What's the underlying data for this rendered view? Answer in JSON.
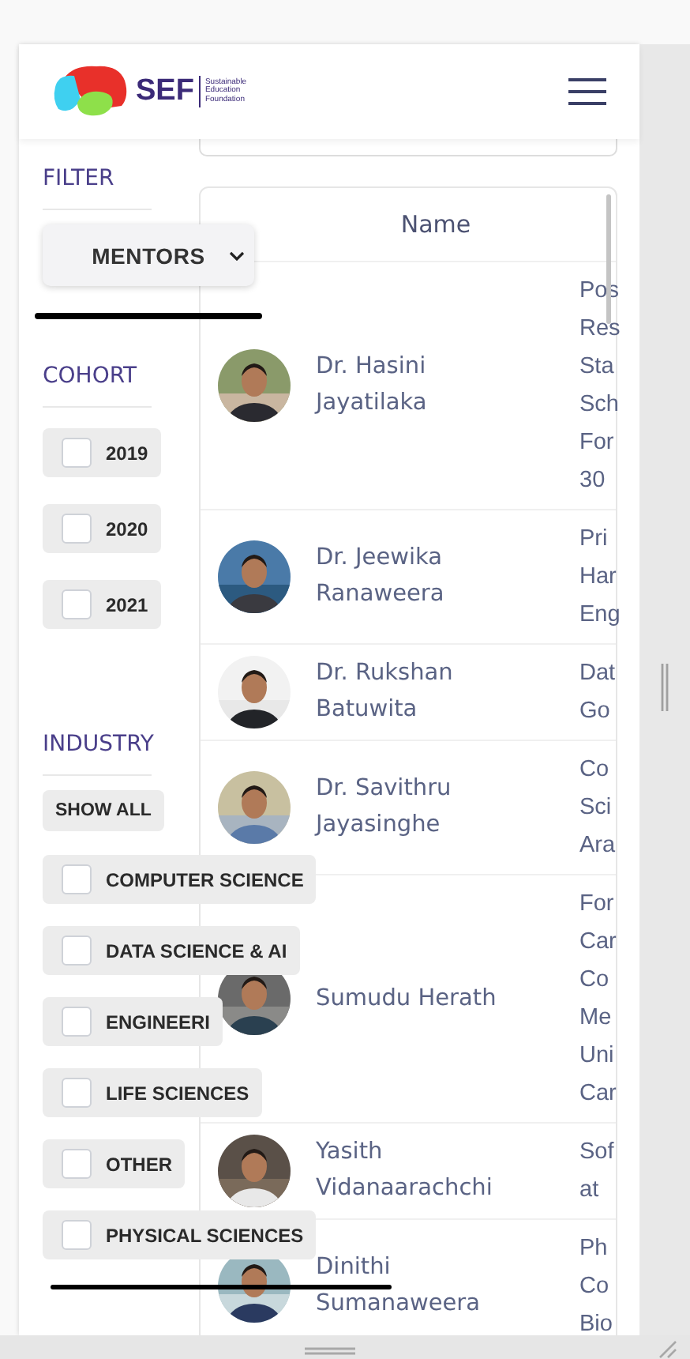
{
  "header": {
    "logo": {
      "mark": "SEF",
      "tagline": [
        "Sustainable",
        "Education",
        "Foundation"
      ]
    }
  },
  "filter": {
    "title": "FILTER",
    "dropdown": "MENTORS"
  },
  "cohort": {
    "title": "COHORT",
    "options": [
      {
        "label": "2019",
        "checked": false
      },
      {
        "label": "2020",
        "checked": false
      },
      {
        "label": "2021",
        "checked": false
      }
    ]
  },
  "industry": {
    "title": "INDUSTRY",
    "show_all": "SHOW ALL",
    "options": [
      {
        "label": "COMPUTER SCIENCE",
        "checked": false
      },
      {
        "label": "DATA SCIENCE & AI",
        "checked": false
      },
      {
        "label": "ENGINEERI",
        "checked": false
      },
      {
        "label": "LIFE SCIENCES",
        "checked": false
      },
      {
        "label": "OTHER",
        "checked": false
      },
      {
        "label": "PHYSICAL SCIENCES",
        "checked": false
      }
    ]
  },
  "table": {
    "columns": [
      "Name"
    ],
    "rows": [
      {
        "name": "Dr. Hasini Jayatilaka",
        "column_2": [
          "Pos",
          "Res",
          "Sta",
          "Sch",
          "For",
          "30"
        ]
      },
      {
        "name": "Dr. Jeewika Ranaweera",
        "column_2": [
          "Pri",
          "Har",
          "Eng"
        ]
      },
      {
        "name": "Dr. Rukshan Batuwita",
        "column_2": [
          "Dat",
          "Go"
        ]
      },
      {
        "name": "Dr. Savithru Jayasinghe",
        "column_2": [
          "Co",
          "Sci",
          "Ara"
        ]
      },
      {
        "name": "Sumudu Herath",
        "column_2": [
          "For",
          "Car",
          "Co",
          "Me",
          "Uni",
          "Car"
        ]
      },
      {
        "name": "Yasith Vidanaarachchi",
        "column_2": [
          "Sof",
          "at"
        ]
      },
      {
        "name": "Dinithi Sumanaweera",
        "column_2": [
          "Ph",
          "Co",
          "Bio"
        ]
      }
    ]
  }
}
